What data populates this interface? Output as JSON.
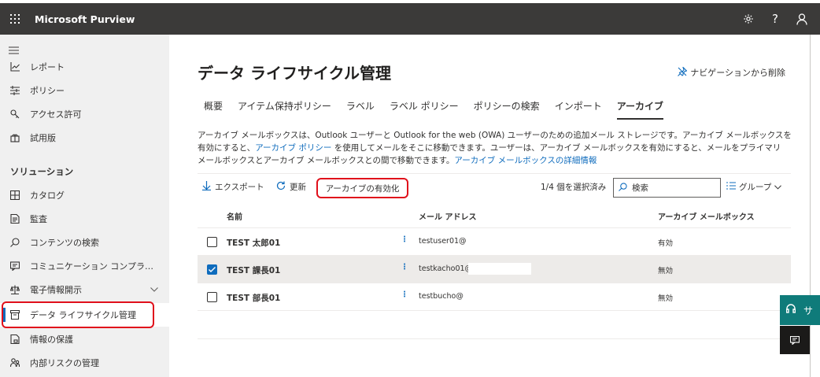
{
  "app": {
    "title": "Microsoft Purview"
  },
  "sidebar": {
    "items_top": [
      {
        "label": "レポート",
        "icon": "chart-icon"
      },
      {
        "label": "ポリシー",
        "icon": "policy-icon"
      },
      {
        "label": "アクセス許可",
        "icon": "key-icon"
      },
      {
        "label": "試用版",
        "icon": "trial-icon"
      }
    ],
    "section": "ソリューション",
    "items_solutions": [
      {
        "label": "カタログ",
        "icon": "catalog-icon"
      },
      {
        "label": "監査",
        "icon": "audit-icon"
      },
      {
        "label": "コンテンツの検索",
        "icon": "search-icon"
      },
      {
        "label": "コミュニケーション コンプライアンス",
        "icon": "chat-icon"
      },
      {
        "label": "電子情報開示",
        "icon": "ediscovery-icon"
      },
      {
        "label": "データ ライフサイクル管理",
        "icon": "archive-icon"
      },
      {
        "label": "情報の保護",
        "icon": "protect-icon"
      },
      {
        "label": "内部リスクの管理",
        "icon": "users-icon"
      }
    ]
  },
  "main": {
    "title": "データ ライフサイクル管理",
    "remove_nav": "ナビゲーションから削除",
    "tabs": [
      "概要",
      "アイテム保持ポリシー",
      "ラベル",
      "ラベル ポリシー",
      "ポリシーの検索",
      "インポート",
      "アーカイブ"
    ],
    "selected_tab": "アーカイブ",
    "desc": {
      "p1": "アーカイブ メールボックスは、Outlook ユーザーと Outlook for the web (OWA) ユーザーのための追加メール ストレージです。アーカイブ メールボックスを有効にすると、",
      "link1": "アーカイブ ポリシー",
      "p2": " を使用してメールをそこに移動できます。ユーザーは、アーカイブ メールボックスを有効にすると、メールをプライマリ メールボックスとアーカイブ メールボックスとの間で移動できます。",
      "link2": "アーカイブ メールボックスの詳細情報"
    },
    "toolbar": {
      "export": "エクスポート",
      "refresh": "更新",
      "enable": "アーカイブの有効化",
      "selection": "1/4 個を選択済み",
      "search_placeholder": "検索",
      "group": "グループ"
    },
    "table": {
      "headers": {
        "name": "名前",
        "mail": "メール アドレス",
        "archive": "アーカイブ メールボックス"
      },
      "rows": [
        {
          "name": "TEST 太郎01",
          "mail": "testuser01@",
          "archive": "有効",
          "checked": false
        },
        {
          "name": "TEST 課長01",
          "mail": "testkacho01@",
          "archive": "無効",
          "checked": true
        },
        {
          "name": "TEST 部長01",
          "mail": "testbucho@",
          "archive": "無効",
          "checked": false
        }
      ]
    }
  },
  "fab": {
    "label": "サ"
  },
  "colors": {
    "accent": "#0f6cbd",
    "highlight": "#e0101b",
    "topbar": "#3b3a39",
    "sidebar": "#f0f0f0"
  }
}
